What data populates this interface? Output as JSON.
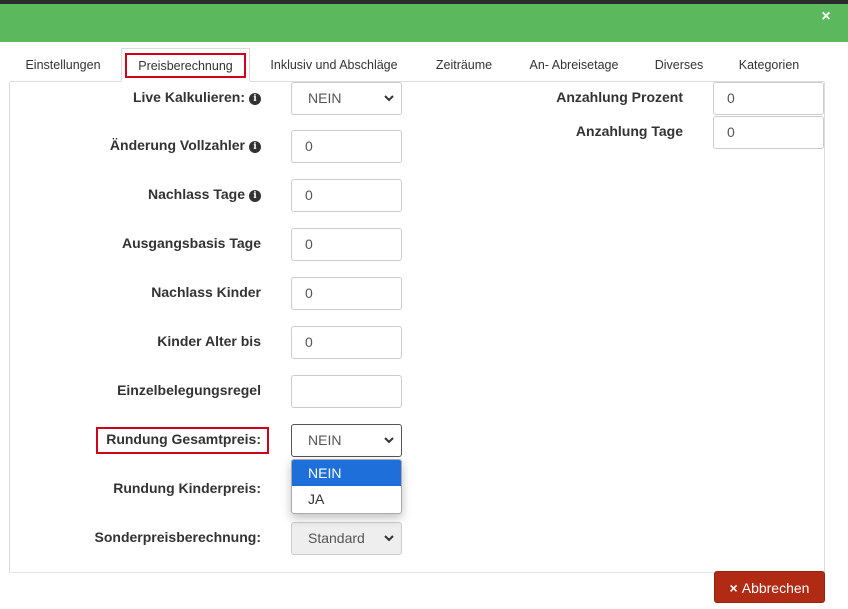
{
  "window": {
    "close_icon": "×"
  },
  "tabs": [
    {
      "label": "Einstellungen"
    },
    {
      "label": "Preisberechnung",
      "active": true
    },
    {
      "label": "Inklusiv und Abschläge"
    },
    {
      "label": "Zeiträume"
    },
    {
      "label": "An- Abreisetage"
    },
    {
      "label": "Diverses"
    },
    {
      "label": "Kategorien"
    }
  ],
  "left_fields": [
    {
      "label": "Live Kalkulieren:",
      "type": "select",
      "value": "NEIN",
      "info": true
    },
    {
      "label": "Änderung Vollzahler",
      "type": "input",
      "value": "0",
      "info": true
    },
    {
      "label": "Nachlass Tage",
      "type": "input",
      "value": "0",
      "info": true
    },
    {
      "label": "Ausgangsbasis Tage",
      "type": "input",
      "value": "0"
    },
    {
      "label": "Nachlass Kinder",
      "type": "input",
      "value": "0"
    },
    {
      "label": "Kinder Alter bis",
      "type": "input",
      "value": "0"
    },
    {
      "label": "Einzelbelegungsregel",
      "type": "input",
      "value": ""
    },
    {
      "label": "Rundung Gesamtpreis:",
      "type": "select",
      "value": "NEIN",
      "focused": true
    },
    {
      "label": "Rundung Kinderpreis:",
      "type": "select",
      "value": ""
    },
    {
      "label": "Sonderpreisberechnung:",
      "type": "select",
      "value": "Standard",
      "disabled": true
    }
  ],
  "right_fields": [
    {
      "label": "Anzahlung Prozent",
      "value": "0"
    },
    {
      "label": "Anzahlung Tage",
      "value": "0"
    }
  ],
  "dropdown": {
    "options": [
      {
        "label": "NEIN",
        "selected": true
      },
      {
        "label": "JA"
      }
    ]
  },
  "footer": {
    "cancel_label": "Abbrechen",
    "cancel_icon": "×"
  },
  "colors": {
    "header": "#5cb85c",
    "cancel": "#b12b14",
    "highlight": "#d0021b",
    "option_selected": "#1e6fd9"
  }
}
